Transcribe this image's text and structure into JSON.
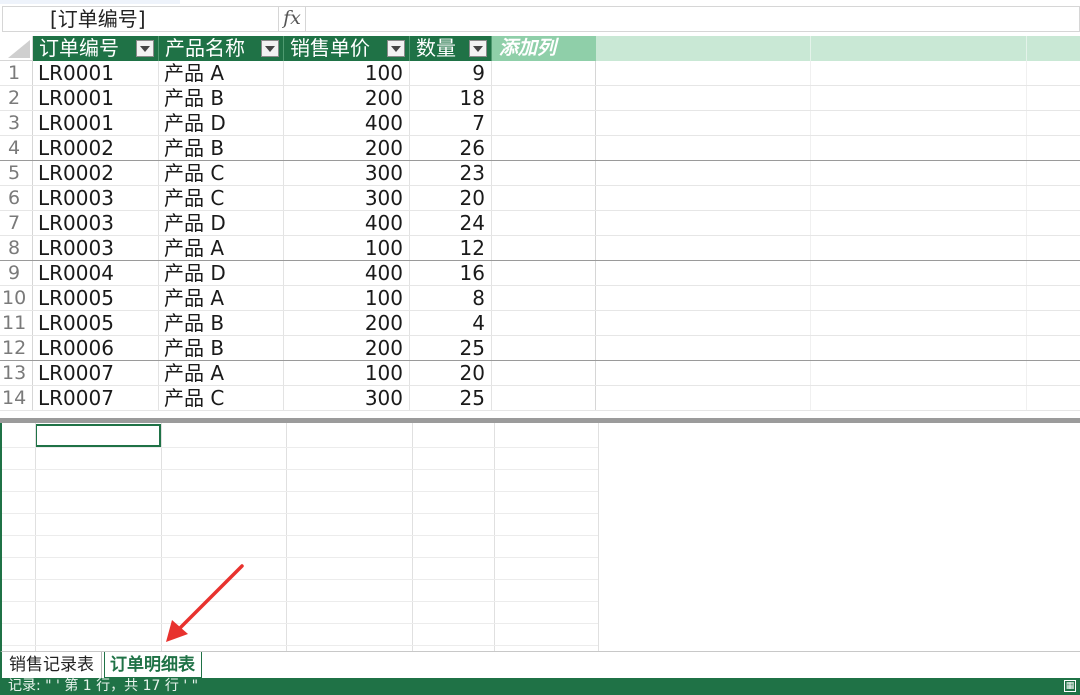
{
  "formula_bar": {
    "name_box": "[订单编号]",
    "fx": "fx",
    "formula_value": ""
  },
  "table": {
    "columns": [
      "订单编号",
      "产品名称",
      "销售单价",
      "数量"
    ],
    "add_column_label": "添加列",
    "rows": [
      {
        "num": "1",
        "id": "LR0001",
        "product": "产品 A",
        "price": "100",
        "qty": "9"
      },
      {
        "num": "2",
        "id": "LR0001",
        "product": "产品 B",
        "price": "200",
        "qty": "18"
      },
      {
        "num": "3",
        "id": "LR0001",
        "product": "产品 D",
        "price": "400",
        "qty": "7"
      },
      {
        "num": "4",
        "id": "LR0002",
        "product": "产品 B",
        "price": "200",
        "qty": "26"
      },
      {
        "num": "5",
        "id": "LR0002",
        "product": "产品 C",
        "price": "300",
        "qty": "23"
      },
      {
        "num": "6",
        "id": "LR0003",
        "product": "产品 C",
        "price": "300",
        "qty": "20"
      },
      {
        "num": "7",
        "id": "LR0003",
        "product": "产品 D",
        "price": "400",
        "qty": "24"
      },
      {
        "num": "8",
        "id": "LR0003",
        "product": "产品 A",
        "price": "100",
        "qty": "12"
      },
      {
        "num": "9",
        "id": "LR0004",
        "product": "产品 D",
        "price": "400",
        "qty": "16"
      },
      {
        "num": "10",
        "id": "LR0005",
        "product": "产品 A",
        "price": "100",
        "qty": "8"
      },
      {
        "num": "11",
        "id": "LR0005",
        "product": "产品 B",
        "price": "200",
        "qty": "4"
      },
      {
        "num": "12",
        "id": "LR0006",
        "product": "产品 B",
        "price": "200",
        "qty": "25"
      },
      {
        "num": "13",
        "id": "LR0007",
        "product": "产品 A",
        "price": "100",
        "qty": "20"
      },
      {
        "num": "14",
        "id": "LR0007",
        "product": "产品 C",
        "price": "300",
        "qty": "25"
      }
    ]
  },
  "sheet_tabs": [
    "销售记录表",
    "订单明细表"
  ],
  "active_tab": "订单明细表",
  "status_bar": {
    "text": "记录: \" '     第 1 行，共 17 行     ' \""
  },
  "colors": {
    "accent": "#1f7246",
    "add_column": "#8fcfa9",
    "arrow": "#e8322e"
  }
}
